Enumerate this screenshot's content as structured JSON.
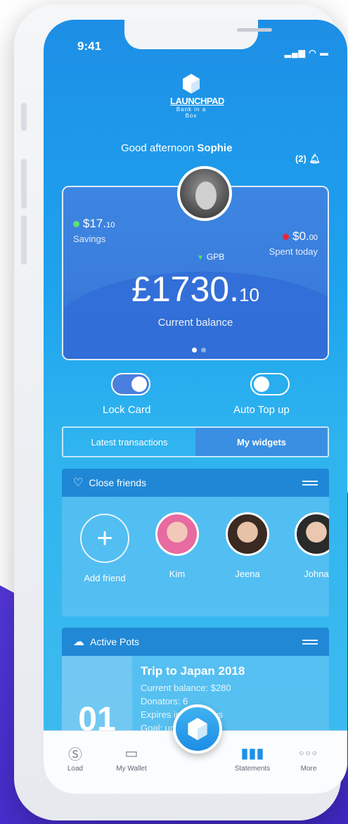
{
  "status": {
    "time": "9:41"
  },
  "logo": {
    "name": "LAUNCHPAD",
    "tagline": "Bank in a Box"
  },
  "greeting": {
    "prefix": "Good afternoon",
    "name": "Sophie"
  },
  "notifications": {
    "count": "(2)"
  },
  "card": {
    "savings": {
      "amount": "$17.",
      "cents": "10",
      "label": "Savings"
    },
    "spent": {
      "amount": "$0.",
      "cents": "00",
      "label": "Spent today"
    },
    "currency": "GPB",
    "balance": {
      "main": "£1730.",
      "cents": "10",
      "label": "Current balance"
    }
  },
  "toggles": {
    "lock_card": "Lock Card",
    "auto_top_up": "Auto Top up"
  },
  "tabs": {
    "latest": "Latest transactions",
    "widgets": "My widgets"
  },
  "friends": {
    "title": "Close friends",
    "add_label": "Add friend",
    "people": [
      {
        "name": "Kim"
      },
      {
        "name": "Jeena"
      },
      {
        "name": "Johna"
      }
    ]
  },
  "pots": {
    "title": "Active Pots",
    "number": "01",
    "name": "Trip to Japan 2018",
    "balance": "Current balance: $280",
    "donators": "Donators: 6",
    "expires": "Expires in: 120 days",
    "goal": "Goal: up"
  },
  "tabbar": {
    "load": "Load",
    "wallet": "My Wallet",
    "statements": "Statements",
    "more": "More"
  },
  "colors": {
    "brand": "#1d8fe6",
    "accent_purple": "#4a2fd0",
    "savings_dot": "#59e07b",
    "spent_dot": "#e8283a"
  }
}
